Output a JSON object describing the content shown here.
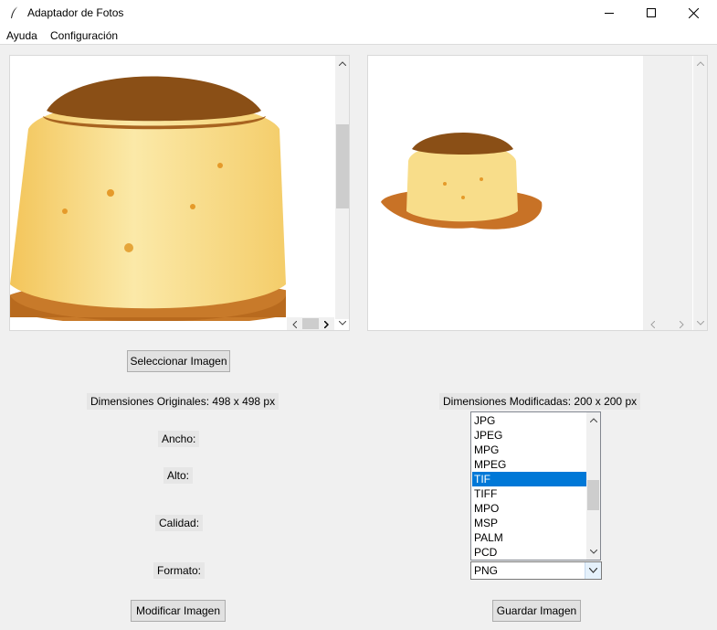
{
  "window": {
    "title": "Adaptador de Fotos"
  },
  "menu": {
    "items": [
      "Ayuda",
      "Configuración"
    ]
  },
  "buttons": {
    "select_image": "Seleccionar Imagen",
    "modify_image": "Modificar Imagen",
    "save_image": "Guardar Imagen"
  },
  "labels": {
    "original_dimensions": "Dimensiones Originales: 498 x 498 px",
    "modified_dimensions": "Dimensiones Modificadas: 200 x 200 px",
    "width": "Ancho:",
    "height": "Alto:",
    "quality": "Calidad:",
    "format": "Formato:"
  },
  "format_list": {
    "items": [
      "JPG",
      "JPEG",
      "MPG",
      "MPEG",
      "TIF",
      "TIFF",
      "MPO",
      "MSP",
      "PALM",
      "PCD"
    ],
    "selected": "TIF"
  },
  "format_combo": {
    "value": "PNG"
  },
  "images": {
    "original": "flan-dessert-large",
    "modified": "flan-dessert-small"
  },
  "colors": {
    "selection": "#0078d7",
    "caramel": "#8a4f16",
    "custard": "#f6d77a"
  }
}
